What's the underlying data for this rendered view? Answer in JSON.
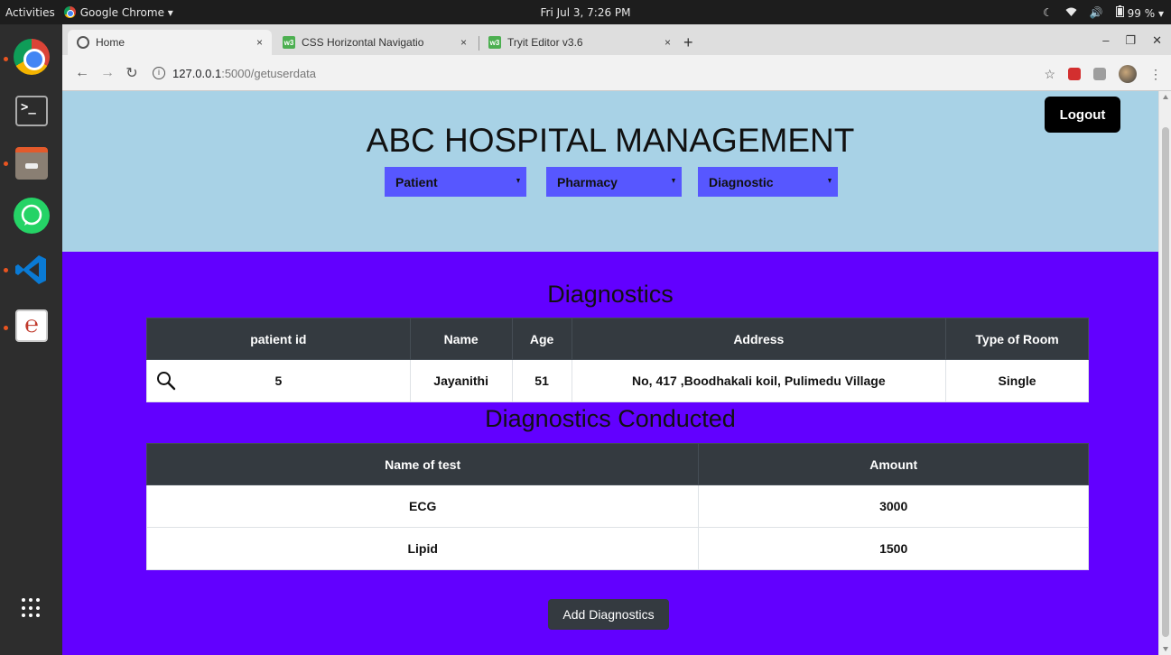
{
  "os": {
    "activities": "Activities",
    "app_menu": "Google Chrome ▾",
    "clock": "Fri Jul  3,  7:26 PM",
    "battery": "99 % ▾"
  },
  "browser": {
    "tabs": [
      {
        "title": "Home",
        "close": "×"
      },
      {
        "title": "CSS Horizontal Navigatio",
        "close": "×"
      },
      {
        "title": "Tryit Editor v3.6",
        "close": "×"
      }
    ],
    "new_tab": "+",
    "url_host": "127.0.0.1",
    "url_path": ":5000/getuserdata"
  },
  "page": {
    "title": "ABC HOSPITAL MANAGEMENT",
    "logout_label": "Logout",
    "menus": [
      "Patient",
      "Pharmacy",
      "Diagnostic"
    ],
    "colors": {
      "header_bg": "#a8d2e6",
      "body_bg": "#6200ff",
      "menu_bg": "#5757ff"
    },
    "diagnostics": {
      "heading": "Diagnostics",
      "columns": [
        "patient id",
        "Name",
        "Age",
        "Address",
        "Type of Room"
      ],
      "row": {
        "patient_id": "5",
        "name": "Jayanithi",
        "age": "51",
        "address": "No, 417 ,Boodhakali koil, Pulimedu Village",
        "room_type": "Single"
      }
    },
    "conducted": {
      "heading": "Diagnostics Conducted",
      "columns": [
        "Name of test",
        "Amount"
      ],
      "rows": [
        {
          "test": "ECG",
          "amount": "3000"
        },
        {
          "test": "Lipid",
          "amount": "1500"
        }
      ]
    },
    "add_button_label": "Add Diagnostics"
  }
}
